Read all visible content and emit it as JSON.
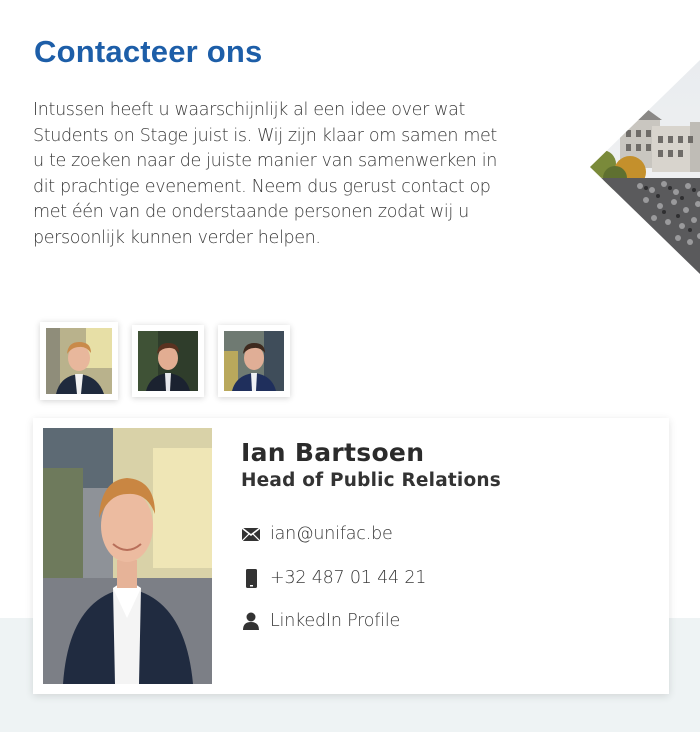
{
  "page": {
    "title": "Contacteer ons",
    "intro": "Intussen heeft u waarschijnlijk al een idee over wat Students on Stage juist is. Wij zijn klaar om samen met u te zoeken naar de juiste manier van samenwerken in dit prachtige evenement. Neem dus gerust contact op met één van de onderstaande personen zodat wij u persoonlijk kunnen verder helpen."
  },
  "colors": {
    "heading": "#1d5ea8",
    "background_band": "#eef3f4"
  },
  "team_thumbnails": [
    {
      "person": "Ian Bartsoen",
      "selected": true
    },
    {
      "person": "team member 2",
      "selected": false
    },
    {
      "person": "team member 3",
      "selected": false
    }
  ],
  "contact_card": {
    "name": "Ian Bartsoen",
    "role": "Head of Public Relations",
    "email": "ian@unifac.be",
    "phone": "+32 487 01 44 21",
    "linkedin": "LinkedIn Profile",
    "icons": {
      "email": "envelope-icon",
      "phone": "phone-icon",
      "linkedin": "person-icon"
    }
  }
}
